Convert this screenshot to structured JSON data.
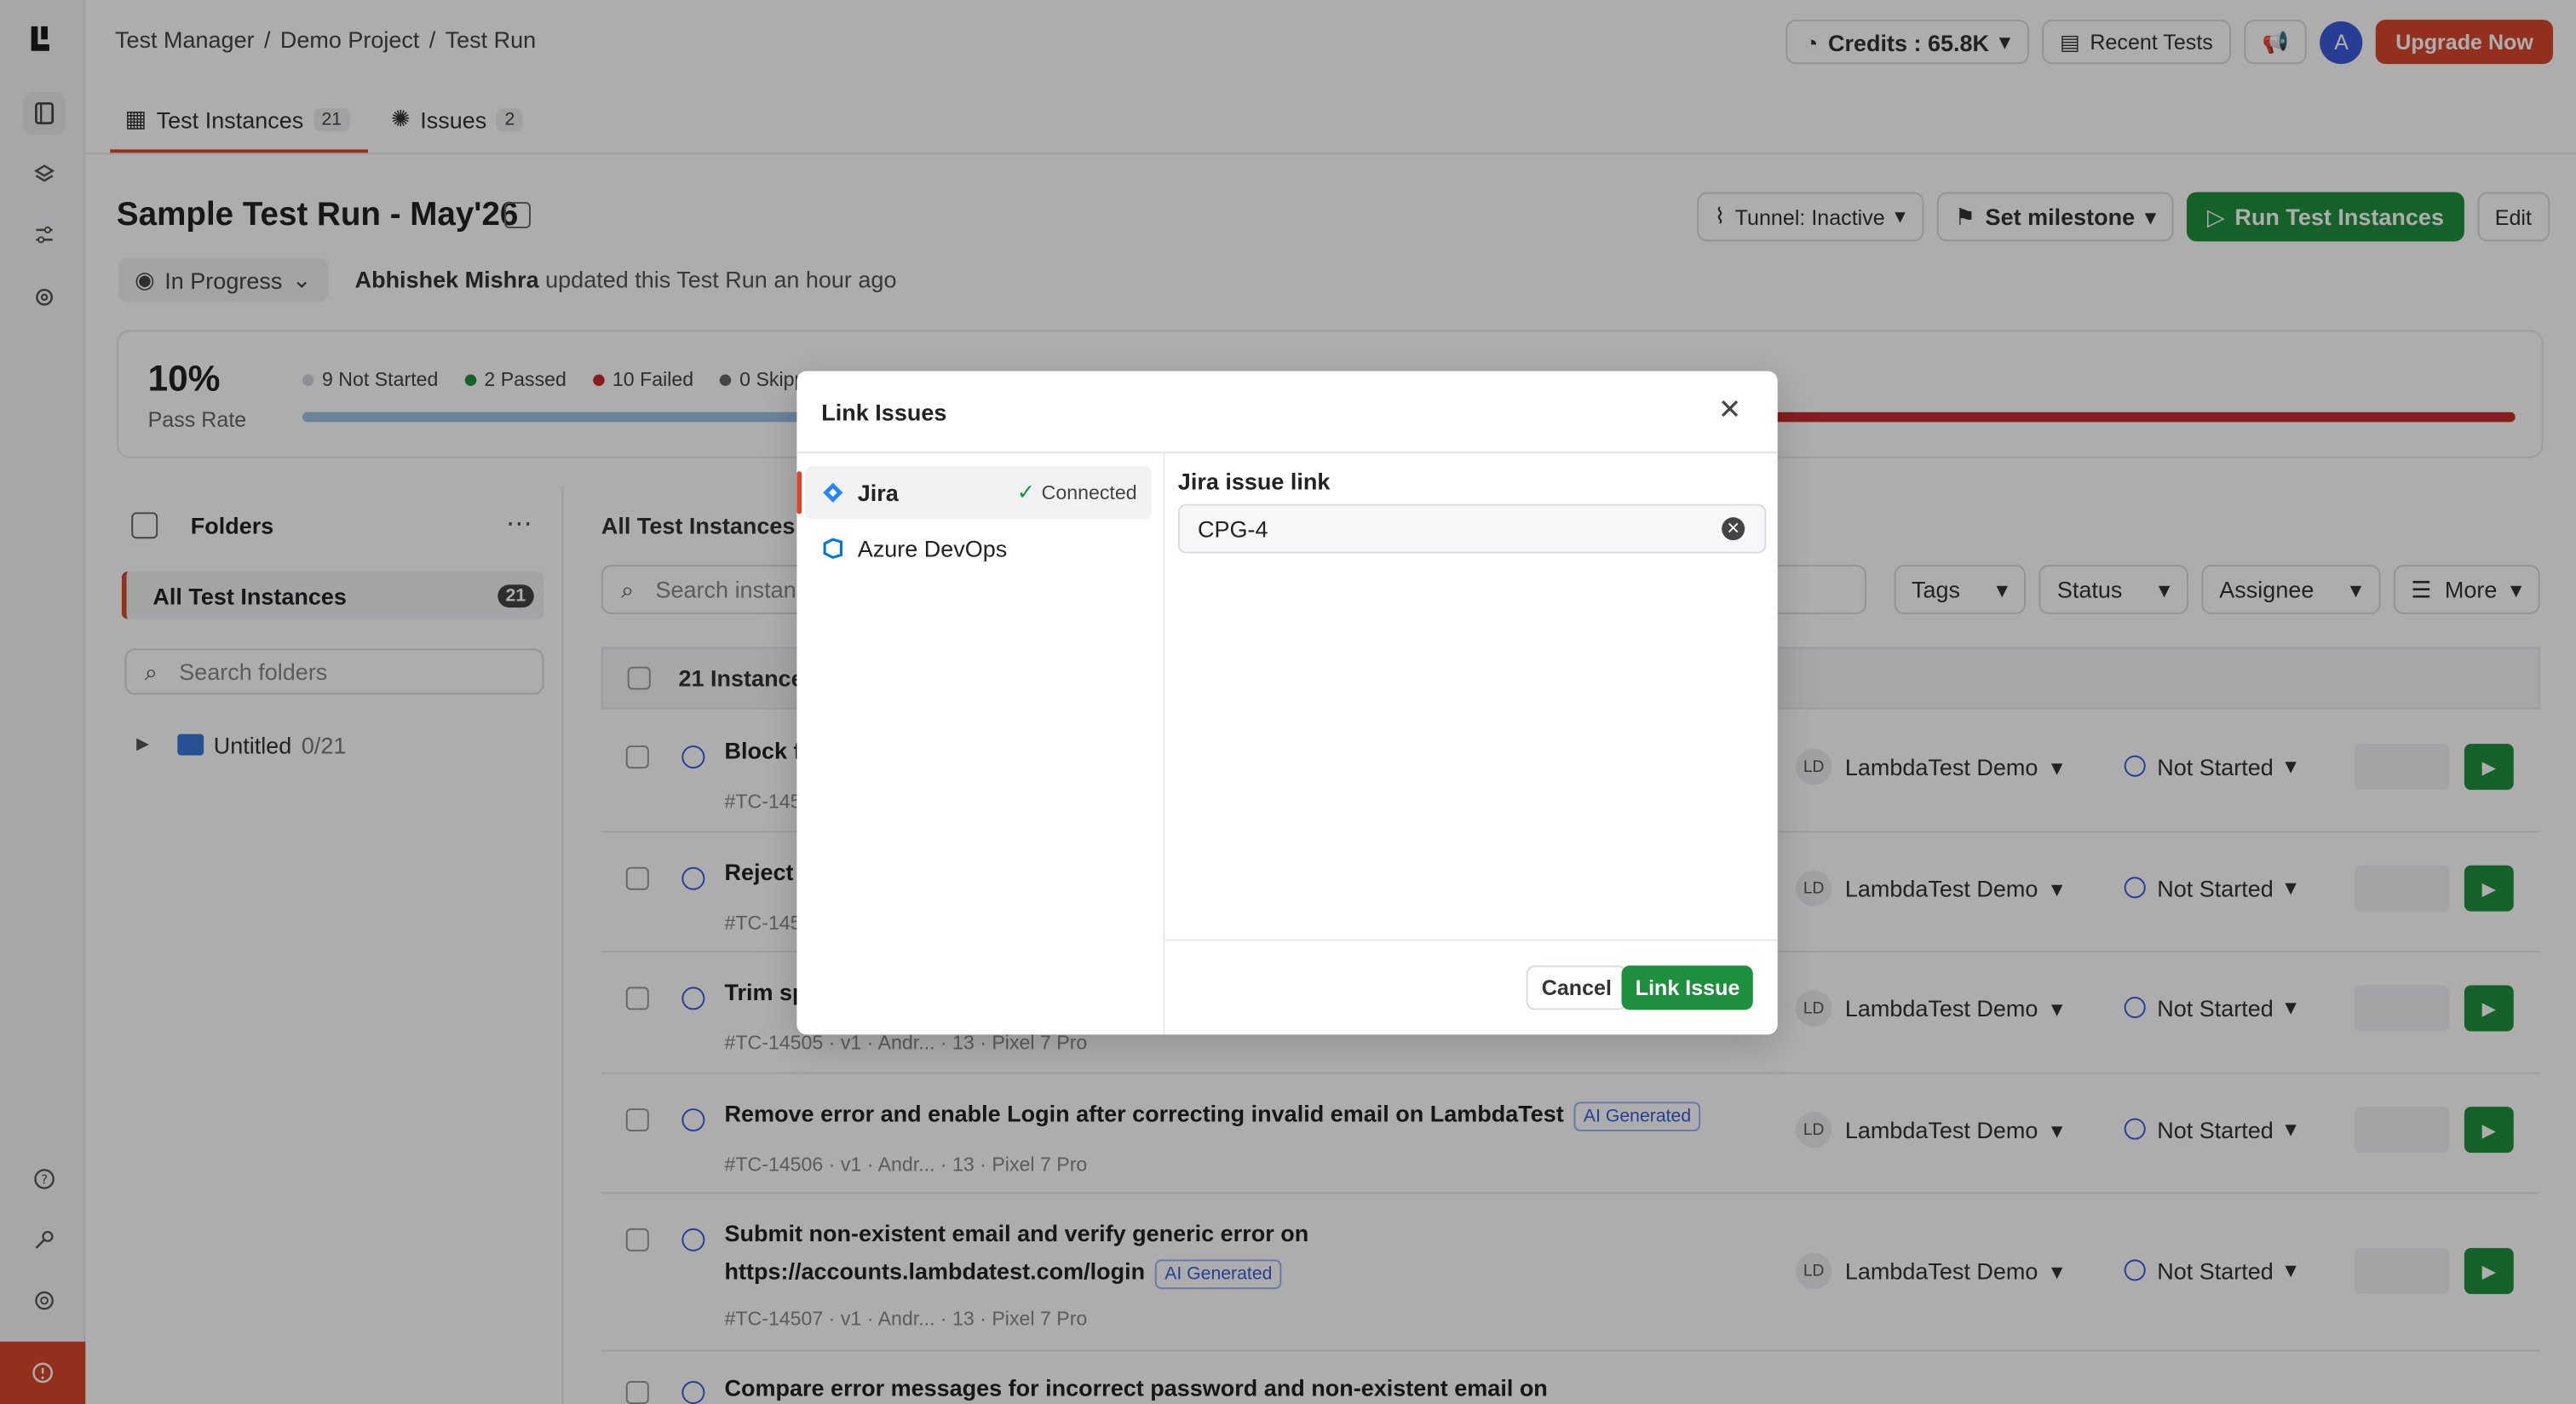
{
  "colors": {
    "accent": "#d9472b",
    "primary_green": "#1e8f3e",
    "link_blue": "#3a5bd9",
    "failed_red": "#c72c2c"
  },
  "breadcrumb": [
    "Test Manager",
    "Demo Project",
    "Test Run"
  ],
  "topbar": {
    "credits": "Credits : 65.8K",
    "recent_tests": "Recent Tests",
    "avatar_letter": "A",
    "upgrade": "Upgrade Now"
  },
  "tabs": [
    {
      "label": "Test Instances",
      "count": "21"
    },
    {
      "label": "Issues",
      "count": "2"
    }
  ],
  "header": {
    "title": "Sample Test Run - May'26",
    "status": "In Progress",
    "updated_user": "Abhishek Mishra",
    "updated_text": "updated this Test Run an hour ago",
    "tunnel": "Tunnel: Inactive",
    "milestone": "Set milestone",
    "run": "Run Test Instances",
    "edit": "Edit"
  },
  "stats": {
    "pass_rate": "10%",
    "pass_rate_label": "Pass Rate",
    "legend": [
      {
        "label": "9 Not Started",
        "color": "#d0d4da"
      },
      {
        "label": "2 Passed",
        "color": "#1e8f3e"
      },
      {
        "label": "10 Failed",
        "color": "#c72c2c"
      },
      {
        "label": "0 Skippe",
        "color": "#666666"
      }
    ],
    "failed_fraction": 0.476
  },
  "folders": {
    "title": "Folders",
    "all_label": "All Test Instances",
    "all_count": "21",
    "search_placeholder": "Search folders",
    "folder_name": "Untitled",
    "folder_count": "0/21"
  },
  "list": {
    "title": "All Test Instances",
    "search_placeholder": "Search instanc",
    "filters": [
      "Tags",
      "Status",
      "Assignee",
      "More"
    ],
    "header": "21 Instances",
    "rows": [
      {
        "title": "Block fo",
        "meta": "#TC-145",
        "assignee": "LambdaTest Demo",
        "status": "Not Started"
      },
      {
        "title": "Reject c",
        "meta": "#TC-145",
        "assignee": "LambdaTest Demo",
        "status": "Not Started"
      },
      {
        "title": "Trim sp",
        "meta": "#TC-14505 · v1 · Andr... · 13 · Pixel 7 Pro",
        "assignee": "LambdaTest Demo",
        "status": "Not Started"
      },
      {
        "title": "Remove error and enable Login after correcting invalid email on LambdaTest",
        "ai": "AI Generated",
        "meta": "#TC-14506 · v1 · Andr... · 13 · Pixel 7 Pro",
        "assignee": "LambdaTest Demo",
        "status": "Not Started"
      },
      {
        "title": "Submit non-existent email and verify generic error on",
        "title2": "https://accounts.lambdatest.com/login",
        "ai": "AI Generated",
        "meta": "#TC-14507 · v1 · Andr... · 13 · Pixel 7 Pro",
        "assignee": "LambdaTest Demo",
        "status": "Not Started"
      },
      {
        "title": "Compare error messages for incorrect password and non-existent email on"
      }
    ],
    "assignee_initials": "LD"
  },
  "modal": {
    "title": "Link Issues",
    "providers": [
      {
        "name": "Jira",
        "status": "Connected"
      },
      {
        "name": "Azure DevOps"
      }
    ],
    "field_label": "Jira issue link",
    "field_value": "CPG-4",
    "cancel": "Cancel",
    "submit": "Link Issue"
  }
}
